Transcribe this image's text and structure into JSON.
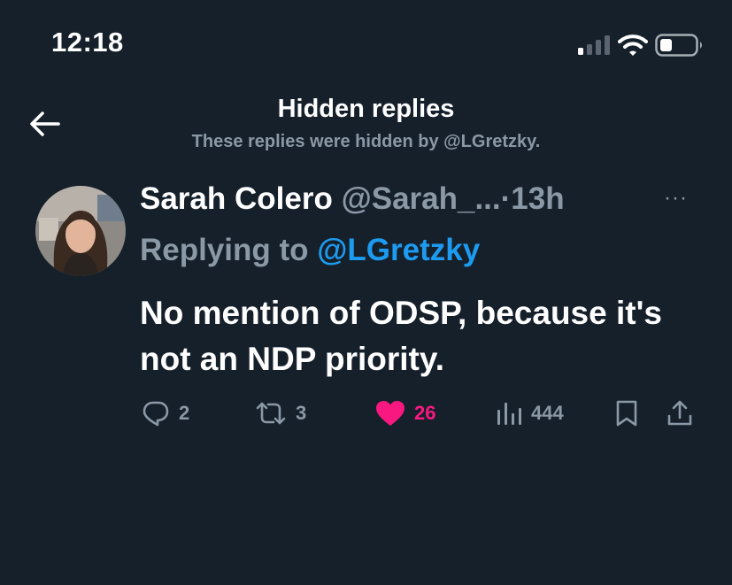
{
  "status_bar": {
    "time": "12:18",
    "icons": [
      "signal-icon",
      "wifi-icon",
      "battery-icon"
    ]
  },
  "header": {
    "title": "Hidden replies",
    "subtitle": "These replies were hidden by @LGretzky."
  },
  "tweet": {
    "author_name": "Sarah Colero",
    "author_handle": "@Sarah_...",
    "separator": "·",
    "time_ago": "13h",
    "more_icon": "···",
    "replying_prefix": "Replying to",
    "replying_to": "@LGretzky",
    "text": "No mention of ODSP, because it's not an NDP priority.",
    "actions": {
      "replies": "2",
      "retweets": "3",
      "likes": "26",
      "views": "444"
    }
  },
  "colors": {
    "background": "#15202b",
    "secondary_text": "#8b98a5",
    "mention": "#1d9bf0",
    "like": "#f91880"
  }
}
